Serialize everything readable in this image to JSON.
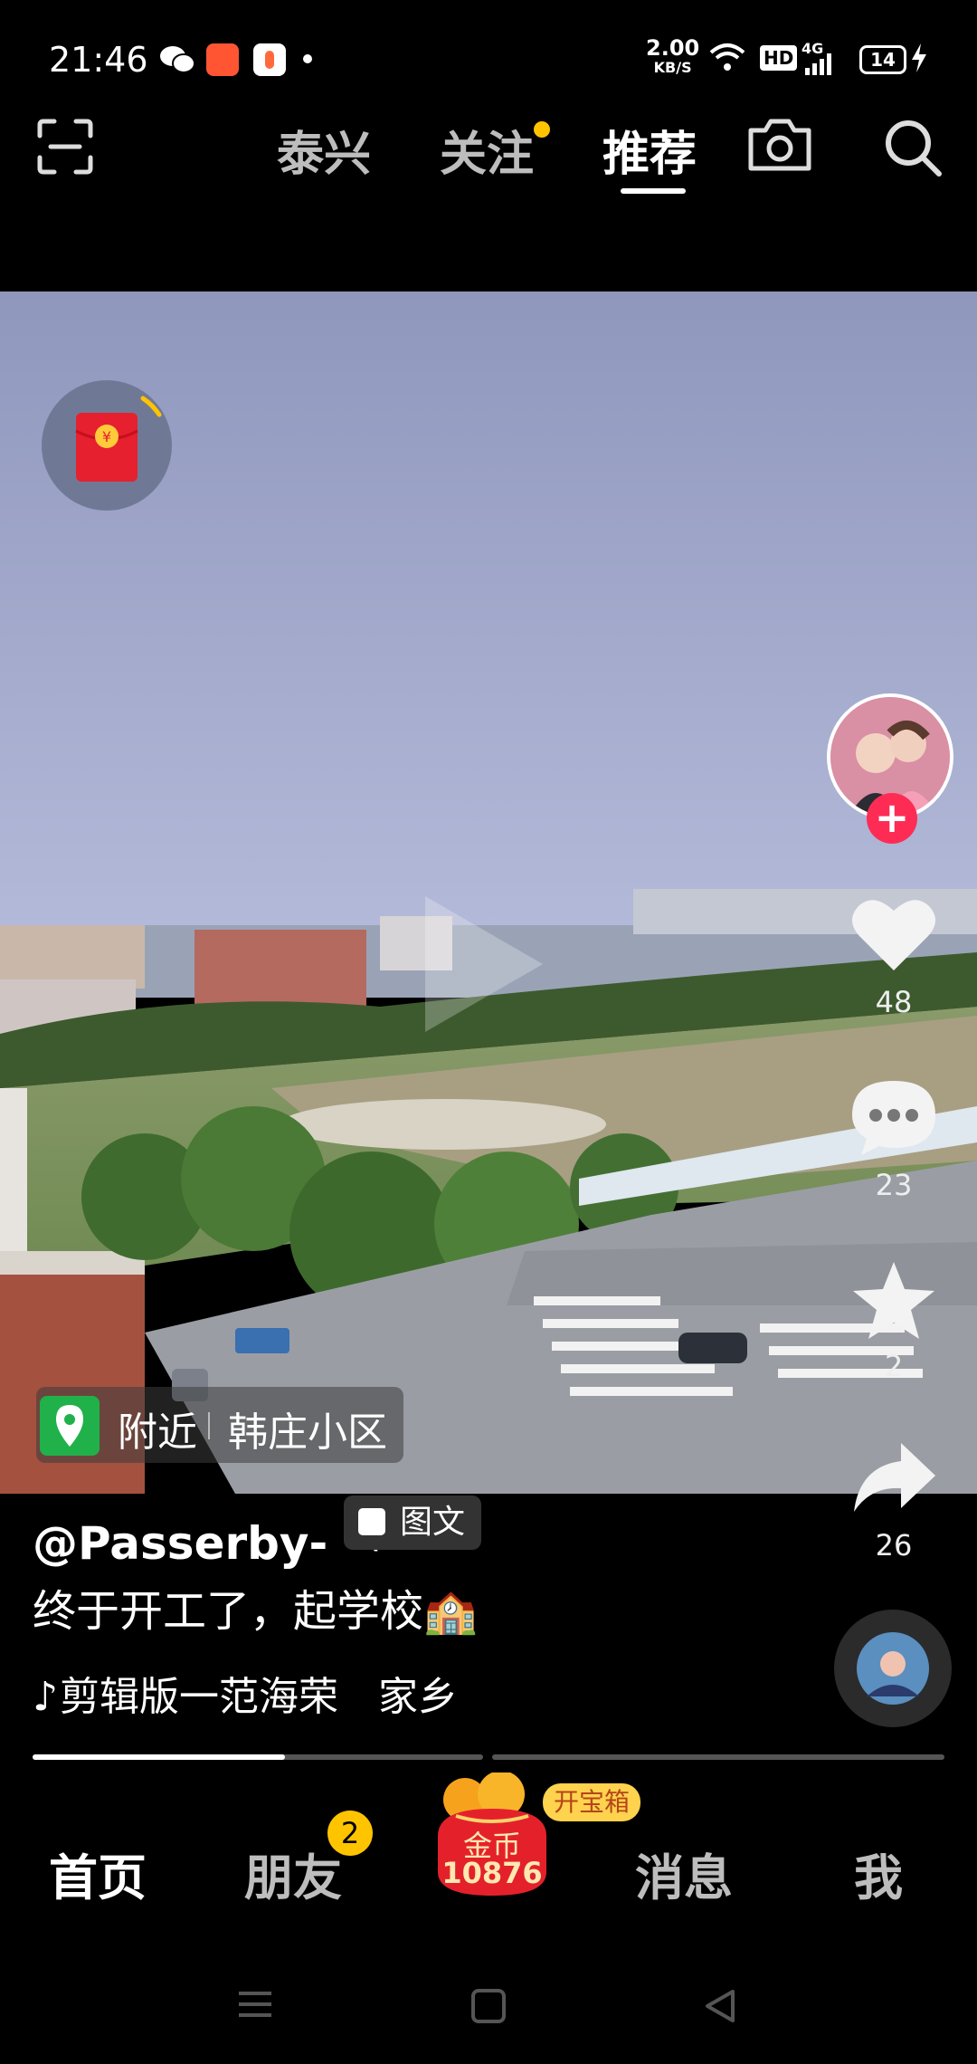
{
  "status_bar": {
    "time": "21:46",
    "net_speed_value": "2.00",
    "net_speed_unit": "KB/S",
    "hd": "HD",
    "network": "4G",
    "battery": "14",
    "icons": [
      "wechat-icon",
      "app-icon",
      "app-icon",
      "dot-icon",
      "wifi-icon",
      "signal-icon",
      "charging-icon"
    ]
  },
  "top_nav": {
    "tabs": [
      {
        "label": "泰兴"
      },
      {
        "label": "关注"
      },
      {
        "label": "推荐"
      }
    ],
    "active_tab": "推荐"
  },
  "post": {
    "location_label": "附近",
    "location_name": "韩庄小区",
    "author": "@Passerby- ཨོཾ",
    "post_type": "图文",
    "caption": "终于开工了，起学校🏫",
    "music": "剪辑版一范海荣　家乡",
    "likes": "48",
    "comments": "23",
    "favorites": "2",
    "shares": "26",
    "progress_fraction": 0.56
  },
  "bottom_nav": {
    "home": "首页",
    "friends": "朋友",
    "friends_badge": "2",
    "coins_label": "金币",
    "coins_value": "10876",
    "treasure_label": "开宝箱",
    "messages": "消息",
    "me": "我"
  },
  "colors": {
    "accent_red": "#fe2c55",
    "badge_yellow": "#ffc300",
    "location_green": "#20b14a"
  }
}
